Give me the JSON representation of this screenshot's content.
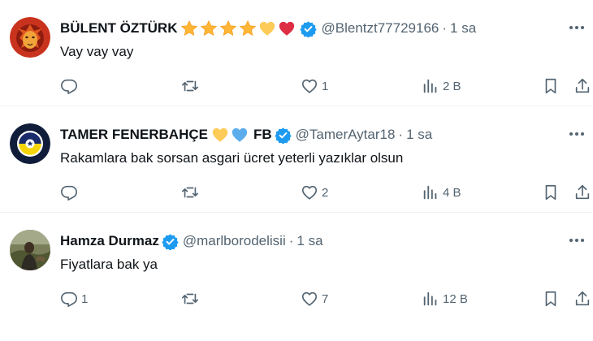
{
  "colors": {
    "text": "#0f1419",
    "secondary": "#536471",
    "verified": "#1d9bf0",
    "divider": "#eff3f4"
  },
  "tweets": [
    {
      "name": "BÜLENT ÖZTÜRK",
      "name_emojis": [
        "star",
        "star",
        "star",
        "star",
        "yellow-heart",
        "red-heart"
      ],
      "verified": true,
      "handle": "@Blentzt77729166",
      "separator": "·",
      "time": "1 sa",
      "text": "Vay vay vay",
      "replies": "",
      "retweets": "",
      "likes": "1",
      "views": "2 B",
      "avatar_icon": "lion-avatar"
    },
    {
      "name": "TAMER FENERBAHÇE",
      "name_emojis": [
        "yellow-heart",
        "blue-heart"
      ],
      "name_suffix": "FB",
      "verified": true,
      "handle": "@TamerAytar18",
      "separator": "·",
      "time": "1 sa",
      "text": "Rakamlara bak sorsan asgari ücret yeterli yazıklar olsun",
      "replies": "",
      "retweets": "",
      "likes": "2",
      "views": "4 B",
      "avatar_icon": "fenerbahce-crest-avatar"
    },
    {
      "name": "Hamza Durmaz",
      "name_emojis": [],
      "verified": true,
      "handle": "@marlborodelisii",
      "separator": "·",
      "time": "1 sa",
      "text": "Fiyatlara bak ya",
      "replies": "1",
      "retweets": "",
      "likes": "7",
      "views": "12 B",
      "avatar_icon": "photo-avatar"
    }
  ]
}
